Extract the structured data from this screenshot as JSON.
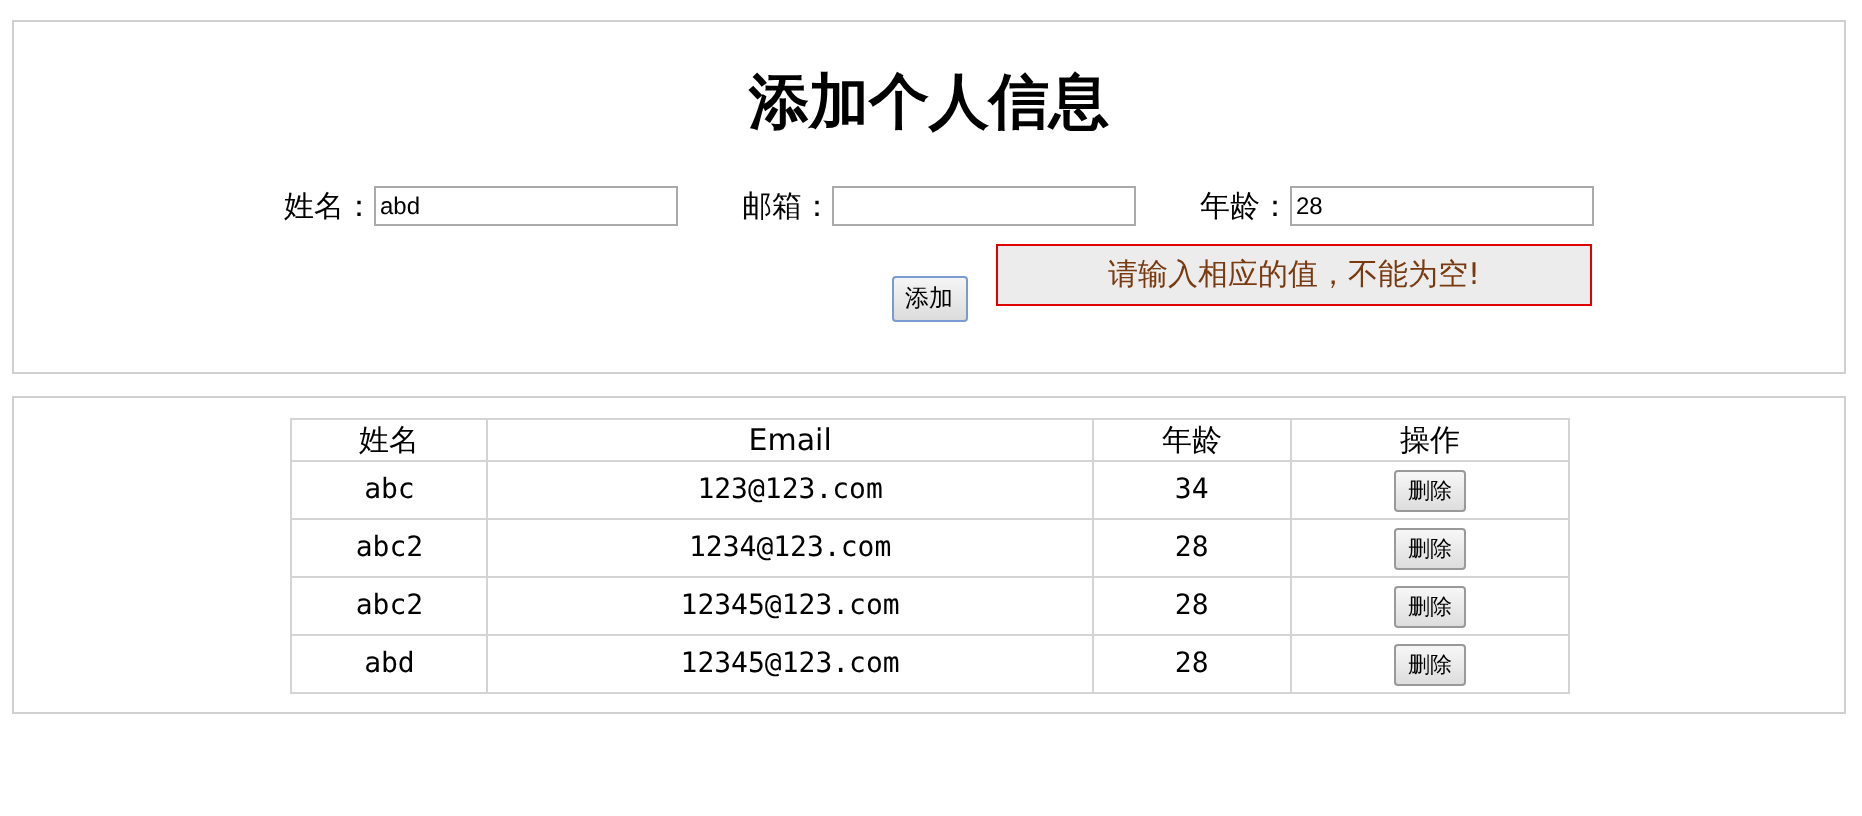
{
  "form": {
    "title": "添加个人信息",
    "fields": [
      {
        "label": "姓名：",
        "value": "abd"
      },
      {
        "label": "邮箱："
      },
      {
        "label": "年龄：",
        "value": "28"
      }
    ],
    "submit": "添加",
    "error": "请输入相应的值，不能为空!"
  },
  "table": {
    "columns": [
      "姓名",
      "Email",
      "年龄",
      "操作"
    ],
    "rows": [
      {
        "name": "abc",
        "email": "123@123.com",
        "age": "34",
        "action": "删除"
      },
      {
        "name": "abc2",
        "email": "1234@123.com",
        "age": "28",
        "action": "删除"
      },
      {
        "name": "abc2",
        "email": "12345@123.com",
        "age": "28",
        "action": "删除"
      },
      {
        "name": "abd",
        "email": "12345@123.com",
        "age": "28",
        "action": "删除"
      }
    ]
  }
}
